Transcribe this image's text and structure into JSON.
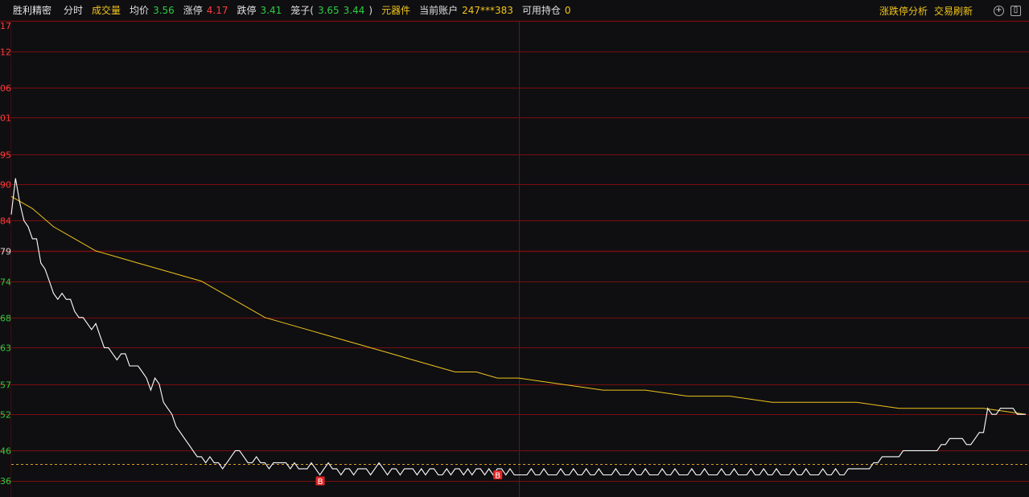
{
  "header": {
    "stock_name": "胜利精密",
    "mode_label": "分时",
    "volume_label": "成交量",
    "avg_label": "均价",
    "avg_value": "3.56",
    "limit_up_label": "涨停",
    "limit_up_value": "4.17",
    "limit_down_label": "跌停",
    "limit_down_value": "3.41",
    "cage_label": "笼子(",
    "cage_high": "3.65",
    "cage_low": "3.44",
    "cage_close": ")",
    "component_label": "元器件",
    "account_label": "当前账户",
    "account_value": "247***383",
    "holding_label": "可用持仓",
    "holding_value": "0",
    "right_link_1": "涨跌停分析",
    "right_link_2": "交易刷新",
    "icon_plus": "+",
    "icon_window": "▯"
  },
  "colors": {
    "background": "#0f0f12",
    "grid": "#7a0d0d",
    "price_line": "#ffffff",
    "avg_line": "#f0c419",
    "up_label": "#ff3b3b",
    "down_label": "#2ecc40",
    "ref_label": "#dddddd",
    "marker": "#e32626"
  },
  "chart_data": {
    "type": "line",
    "y_ticks": [
      {
        "label": "17",
        "value": 3.917,
        "dir": "up"
      },
      {
        "label": "12",
        "value": 3.912,
        "dir": "up"
      },
      {
        "label": "06",
        "value": 3.906,
        "dir": "up"
      },
      {
        "label": "01",
        "value": 3.901,
        "dir": "up"
      },
      {
        "label": "95",
        "value": 3.895,
        "dir": "up"
      },
      {
        "label": "90",
        "value": 3.89,
        "dir": "up"
      },
      {
        "label": "84",
        "value": 3.884,
        "dir": "up"
      },
      {
        "label": "79",
        "value": 3.879,
        "dir": "ref"
      },
      {
        "label": "74",
        "value": 3.874,
        "dir": "down"
      },
      {
        "label": "68",
        "value": 3.868,
        "dir": "down"
      },
      {
        "label": "63",
        "value": 3.863,
        "dir": "down"
      },
      {
        "label": "57",
        "value": 3.857,
        "dir": "down"
      },
      {
        "label": "52",
        "value": 3.852,
        "dir": "down"
      },
      {
        "label": "46",
        "value": 3.846,
        "dir": "down"
      },
      {
        "label": "36",
        "value": 3.841,
        "dir": "down"
      }
    ],
    "ylim": [
      3.841,
      3.917
    ],
    "reference_price": 3.879,
    "dashed_level": 3.8438,
    "x_range": [
      0,
      240
    ],
    "midline_index": 120,
    "price_series": [
      [
        0,
        3.885
      ],
      [
        1,
        3.891
      ],
      [
        2,
        3.887
      ],
      [
        3,
        3.884
      ],
      [
        4,
        3.883
      ],
      [
        5,
        3.881
      ],
      [
        6,
        3.881
      ],
      [
        7,
        3.877
      ],
      [
        8,
        3.876
      ],
      [
        9,
        3.874
      ],
      [
        10,
        3.872
      ],
      [
        11,
        3.871
      ],
      [
        12,
        3.872
      ],
      [
        13,
        3.871
      ],
      [
        14,
        3.871
      ],
      [
        15,
        3.869
      ],
      [
        16,
        3.868
      ],
      [
        17,
        3.868
      ],
      [
        18,
        3.867
      ],
      [
        19,
        3.866
      ],
      [
        20,
        3.867
      ],
      [
        21,
        3.865
      ],
      [
        22,
        3.863
      ],
      [
        23,
        3.863
      ],
      [
        24,
        3.862
      ],
      [
        25,
        3.861
      ],
      [
        26,
        3.862
      ],
      [
        27,
        3.862
      ],
      [
        28,
        3.86
      ],
      [
        29,
        3.86
      ],
      [
        30,
        3.86
      ],
      [
        31,
        3.859
      ],
      [
        32,
        3.858
      ],
      [
        33,
        3.856
      ],
      [
        34,
        3.858
      ],
      [
        35,
        3.857
      ],
      [
        36,
        3.854
      ],
      [
        37,
        3.853
      ],
      [
        38,
        3.852
      ],
      [
        39,
        3.85
      ],
      [
        40,
        3.849
      ],
      [
        41,
        3.848
      ],
      [
        42,
        3.847
      ],
      [
        43,
        3.846
      ],
      [
        44,
        3.845
      ],
      [
        45,
        3.845
      ],
      [
        46,
        3.844
      ],
      [
        47,
        3.845
      ],
      [
        48,
        3.844
      ],
      [
        49,
        3.844
      ],
      [
        50,
        3.843
      ],
      [
        51,
        3.844
      ],
      [
        52,
        3.845
      ],
      [
        53,
        3.846
      ],
      [
        54,
        3.846
      ],
      [
        55,
        3.845
      ],
      [
        56,
        3.844
      ],
      [
        57,
        3.844
      ],
      [
        58,
        3.845
      ],
      [
        59,
        3.844
      ],
      [
        60,
        3.844
      ],
      [
        61,
        3.843
      ],
      [
        62,
        3.844
      ],
      [
        63,
        3.844
      ],
      [
        64,
        3.844
      ],
      [
        65,
        3.844
      ],
      [
        66,
        3.843
      ],
      [
        67,
        3.844
      ],
      [
        68,
        3.843
      ],
      [
        69,
        3.843
      ],
      [
        70,
        3.843
      ],
      [
        71,
        3.844
      ],
      [
        72,
        3.843
      ],
      [
        73,
        3.842
      ],
      [
        74,
        3.843
      ],
      [
        75,
        3.844
      ],
      [
        76,
        3.843
      ],
      [
        77,
        3.843
      ],
      [
        78,
        3.842
      ],
      [
        79,
        3.843
      ],
      [
        80,
        3.843
      ],
      [
        81,
        3.842
      ],
      [
        82,
        3.843
      ],
      [
        83,
        3.843
      ],
      [
        84,
        3.843
      ],
      [
        85,
        3.842
      ],
      [
        86,
        3.843
      ],
      [
        87,
        3.844
      ],
      [
        88,
        3.843
      ],
      [
        89,
        3.842
      ],
      [
        90,
        3.843
      ],
      [
        91,
        3.843
      ],
      [
        92,
        3.842
      ],
      [
        93,
        3.843
      ],
      [
        94,
        3.843
      ],
      [
        95,
        3.843
      ],
      [
        96,
        3.842
      ],
      [
        97,
        3.843
      ],
      [
        98,
        3.842
      ],
      [
        99,
        3.843
      ],
      [
        100,
        3.843
      ],
      [
        101,
        3.842
      ],
      [
        102,
        3.842
      ],
      [
        103,
        3.843
      ],
      [
        104,
        3.842
      ],
      [
        105,
        3.843
      ],
      [
        106,
        3.843
      ],
      [
        107,
        3.842
      ],
      [
        108,
        3.843
      ],
      [
        109,
        3.842
      ],
      [
        110,
        3.843
      ],
      [
        111,
        3.843
      ],
      [
        112,
        3.842
      ],
      [
        113,
        3.843
      ],
      [
        114,
        3.842
      ],
      [
        115,
        3.843
      ],
      [
        116,
        3.843
      ],
      [
        117,
        3.842
      ],
      [
        118,
        3.843
      ],
      [
        119,
        3.842
      ],
      [
        120,
        3.842
      ],
      [
        121,
        3.842
      ],
      [
        122,
        3.842
      ],
      [
        123,
        3.843
      ],
      [
        124,
        3.842
      ],
      [
        125,
        3.842
      ],
      [
        126,
        3.843
      ],
      [
        127,
        3.842
      ],
      [
        128,
        3.842
      ],
      [
        129,
        3.842
      ],
      [
        130,
        3.843
      ],
      [
        131,
        3.842
      ],
      [
        132,
        3.842
      ],
      [
        133,
        3.843
      ],
      [
        134,
        3.842
      ],
      [
        135,
        3.842
      ],
      [
        136,
        3.843
      ],
      [
        137,
        3.842
      ],
      [
        138,
        3.842
      ],
      [
        139,
        3.843
      ],
      [
        140,
        3.842
      ],
      [
        141,
        3.842
      ],
      [
        142,
        3.842
      ],
      [
        143,
        3.843
      ],
      [
        144,
        3.842
      ],
      [
        145,
        3.842
      ],
      [
        146,
        3.842
      ],
      [
        147,
        3.843
      ],
      [
        148,
        3.842
      ],
      [
        149,
        3.842
      ],
      [
        150,
        3.843
      ],
      [
        151,
        3.842
      ],
      [
        152,
        3.842
      ],
      [
        153,
        3.842
      ],
      [
        154,
        3.843
      ],
      [
        155,
        3.842
      ],
      [
        156,
        3.842
      ],
      [
        157,
        3.843
      ],
      [
        158,
        3.842
      ],
      [
        159,
        3.842
      ],
      [
        160,
        3.842
      ],
      [
        161,
        3.843
      ],
      [
        162,
        3.842
      ],
      [
        163,
        3.842
      ],
      [
        164,
        3.843
      ],
      [
        165,
        3.842
      ],
      [
        166,
        3.842
      ],
      [
        167,
        3.842
      ],
      [
        168,
        3.843
      ],
      [
        169,
        3.842
      ],
      [
        170,
        3.842
      ],
      [
        171,
        3.843
      ],
      [
        172,
        3.842
      ],
      [
        173,
        3.842
      ],
      [
        174,
        3.842
      ],
      [
        175,
        3.843
      ],
      [
        176,
        3.842
      ],
      [
        177,
        3.842
      ],
      [
        178,
        3.843
      ],
      [
        179,
        3.842
      ],
      [
        180,
        3.842
      ],
      [
        181,
        3.843
      ],
      [
        182,
        3.842
      ],
      [
        183,
        3.842
      ],
      [
        184,
        3.842
      ],
      [
        185,
        3.843
      ],
      [
        186,
        3.842
      ],
      [
        187,
        3.842
      ],
      [
        188,
        3.843
      ],
      [
        189,
        3.842
      ],
      [
        190,
        3.842
      ],
      [
        191,
        3.842
      ],
      [
        192,
        3.843
      ],
      [
        193,
        3.842
      ],
      [
        194,
        3.842
      ],
      [
        195,
        3.843
      ],
      [
        196,
        3.842
      ],
      [
        197,
        3.842
      ],
      [
        198,
        3.843
      ],
      [
        199,
        3.843
      ],
      [
        200,
        3.843
      ],
      [
        201,
        3.843
      ],
      [
        202,
        3.843
      ],
      [
        203,
        3.843
      ],
      [
        204,
        3.844
      ],
      [
        205,
        3.844
      ],
      [
        206,
        3.845
      ],
      [
        207,
        3.845
      ],
      [
        208,
        3.845
      ],
      [
        209,
        3.845
      ],
      [
        210,
        3.845
      ],
      [
        211,
        3.846
      ],
      [
        212,
        3.846
      ],
      [
        213,
        3.846
      ],
      [
        214,
        3.846
      ],
      [
        215,
        3.846
      ],
      [
        216,
        3.846
      ],
      [
        217,
        3.846
      ],
      [
        218,
        3.846
      ],
      [
        219,
        3.846
      ],
      [
        220,
        3.847
      ],
      [
        221,
        3.847
      ],
      [
        222,
        3.848
      ],
      [
        223,
        3.848
      ],
      [
        224,
        3.848
      ],
      [
        225,
        3.848
      ],
      [
        226,
        3.847
      ],
      [
        227,
        3.847
      ],
      [
        228,
        3.848
      ],
      [
        229,
        3.849
      ],
      [
        230,
        3.849
      ],
      [
        231,
        3.853
      ],
      [
        232,
        3.852
      ],
      [
        233,
        3.852
      ],
      [
        234,
        3.853
      ],
      [
        235,
        3.853
      ],
      [
        236,
        3.853
      ],
      [
        237,
        3.853
      ],
      [
        238,
        3.852
      ],
      [
        239,
        3.852
      ],
      [
        240,
        3.852
      ]
    ],
    "avg_series": [
      [
        0,
        3.888
      ],
      [
        5,
        3.886
      ],
      [
        10,
        3.883
      ],
      [
        15,
        3.881
      ],
      [
        20,
        3.879
      ],
      [
        25,
        3.878
      ],
      [
        30,
        3.877
      ],
      [
        35,
        3.876
      ],
      [
        40,
        3.875
      ],
      [
        45,
        3.874
      ],
      [
        50,
        3.872
      ],
      [
        55,
        3.87
      ],
      [
        60,
        3.868
      ],
      [
        65,
        3.867
      ],
      [
        70,
        3.866
      ],
      [
        75,
        3.865
      ],
      [
        80,
        3.864
      ],
      [
        85,
        3.863
      ],
      [
        90,
        3.862
      ],
      [
        95,
        3.861
      ],
      [
        100,
        3.86
      ],
      [
        105,
        3.859
      ],
      [
        110,
        3.859
      ],
      [
        115,
        3.858
      ],
      [
        120,
        3.858
      ],
      [
        130,
        3.857
      ],
      [
        140,
        3.856
      ],
      [
        150,
        3.856
      ],
      [
        160,
        3.855
      ],
      [
        170,
        3.855
      ],
      [
        180,
        3.854
      ],
      [
        190,
        3.854
      ],
      [
        200,
        3.854
      ],
      [
        210,
        3.853
      ],
      [
        220,
        3.853
      ],
      [
        230,
        3.853
      ],
      [
        240,
        3.852
      ]
    ],
    "markers": [
      {
        "label": "B",
        "index": 73
      },
      {
        "label": "B",
        "index": 115
      }
    ]
  }
}
